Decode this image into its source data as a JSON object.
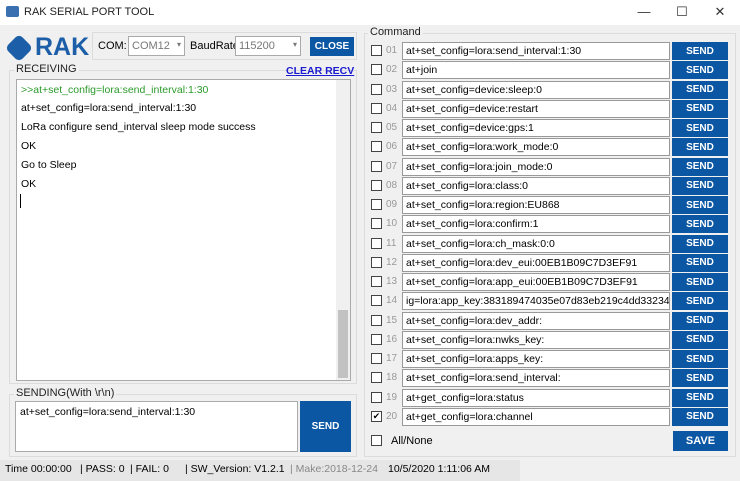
{
  "window": {
    "title": "RAK SERIAL PORT TOOL",
    "minimize": "—",
    "maximize": "☐",
    "close": "✕"
  },
  "logo": "RAK",
  "port": {
    "com_label": "COM:",
    "com_value": "COM12",
    "baud_label": "BaudRate:",
    "baud_value": "115200",
    "close_label": "CLOSE"
  },
  "receiving": {
    "label": "RECEIVING",
    "clear_label": "CLEAR RECV",
    "lines": [
      ">>at+set_config=lora:send_interval:1:30",
      "at+set_config=lora:send_interval:1:30",
      "LoRa configure send_interval sleep mode success",
      "OK",
      "Go to Sleep",
      "OK"
    ]
  },
  "sending": {
    "label": "SENDING(With \\r\\n)",
    "value": "at+set_config=lora:send_interval:1:30",
    "send_label": "SEND"
  },
  "command": {
    "label": "Command",
    "send_label": "SEND",
    "all_none": "All/None",
    "save_label": "SAVE",
    "rows": [
      {
        "n": "01",
        "cmd": "at+set_config=lora:send_interval:1:30",
        "checked": false
      },
      {
        "n": "02",
        "cmd": "at+join",
        "checked": false
      },
      {
        "n": "03",
        "cmd": "at+set_config=device:sleep:0",
        "checked": false
      },
      {
        "n": "04",
        "cmd": "at+set_config=device:restart",
        "checked": false
      },
      {
        "n": "05",
        "cmd": "at+set_config=device:gps:1",
        "checked": false
      },
      {
        "n": "06",
        "cmd": "at+set_config=lora:work_mode:0",
        "checked": false
      },
      {
        "n": "07",
        "cmd": "at+set_config=lora:join_mode:0",
        "checked": false
      },
      {
        "n": "08",
        "cmd": "at+set_config=lora:class:0",
        "checked": false
      },
      {
        "n": "09",
        "cmd": "at+set_config=lora:region:EU868",
        "checked": false
      },
      {
        "n": "10",
        "cmd": "at+set_config=lora:confirm:1",
        "checked": false
      },
      {
        "n": "11",
        "cmd": "at+set_config=lora:ch_mask:0:0",
        "checked": false
      },
      {
        "n": "12",
        "cmd": "at+set_config=lora:dev_eui:00EB1B09C7D3EF91",
        "checked": false
      },
      {
        "n": "13",
        "cmd": "at+set_config=lora:app_eui:00EB1B09C7D3EF91",
        "checked": false
      },
      {
        "n": "14",
        "cmd": "ig=lora:app_key:383189474035e07d83eb219c4dd33234",
        "checked": false
      },
      {
        "n": "15",
        "cmd": "at+set_config=lora:dev_addr:",
        "checked": false
      },
      {
        "n": "16",
        "cmd": "at+set_config=lora:nwks_key:",
        "checked": false
      },
      {
        "n": "17",
        "cmd": "at+set_config=lora:apps_key:",
        "checked": false
      },
      {
        "n": "18",
        "cmd": "at+set_config=lora:send_interval:",
        "checked": false
      },
      {
        "n": "19",
        "cmd": "at+get_config=lora:status",
        "checked": false
      },
      {
        "n": "20",
        "cmd": "at+get_config=lora:channel",
        "checked": true
      }
    ]
  },
  "status": {
    "time": "Time  00:00:00",
    "pass": "| PASS:  0",
    "fail": "| FAIL:  0",
    "version": "| SW_Version:  V1.2.1",
    "make": "| Make:2018-12-24",
    "datetime": "10/5/2020 1:11:06 AM"
  }
}
